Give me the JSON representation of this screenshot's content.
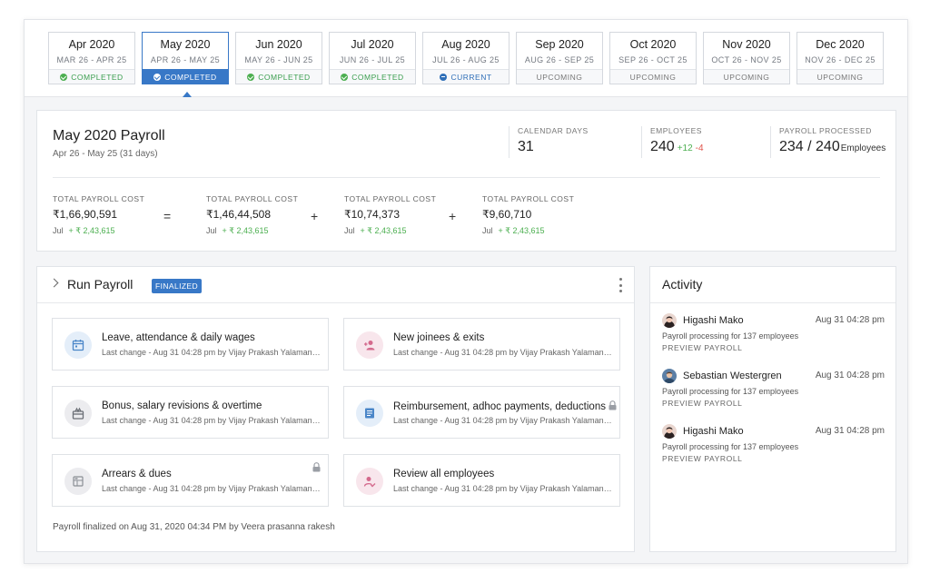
{
  "months": [
    {
      "title": "Apr 2020",
      "range": "MAR 26 - APR 25",
      "status": "COMPLETED"
    },
    {
      "title": "May 2020",
      "range": "APR 26 - MAY 25",
      "status": "COMPLETED"
    },
    {
      "title": "Jun 2020",
      "range": "MAY 26 - JUN 25",
      "status": "COMPLETED"
    },
    {
      "title": "Jul 2020",
      "range": "JUN 26 - JUL 25",
      "status": "COMPLETED"
    },
    {
      "title": "Aug 2020",
      "range": "JUL 26 - AUG 25",
      "status": "CURRENT"
    },
    {
      "title": "Sep 2020",
      "range": "AUG 26 - SEP 25",
      "status": "UPCOMING"
    },
    {
      "title": "Oct 2020",
      "range": "SEP 26 - OCT 25",
      "status": "UPCOMING"
    },
    {
      "title": "Nov 2020",
      "range": "OCT 26 - NOV 25",
      "status": "UPCOMING"
    },
    {
      "title": "Dec 2020",
      "range": "NOV 26 - DEC 25",
      "status": "UPCOMING"
    }
  ],
  "summary": {
    "title": "May 2020 Payroll",
    "subtitle": "Apr 26 - May 25 (31 days)",
    "calendar_days_label": "CALENDAR DAYS",
    "calendar_days": "31",
    "employees_label": "EMPLOYEES",
    "employees": "240",
    "employees_added": "+12",
    "employees_removed": "-4",
    "processed_label": "PAYROLL PROCESSED",
    "processed": "234 / 240",
    "processed_unit": "Employees",
    "costs": [
      {
        "label": "TOTAL PAYROLL COST",
        "value": "₹1,66,90,591",
        "month": "Jul",
        "delta": "+ ₹ 2,43,615"
      },
      {
        "label": "TOTAL PAYROLL COST",
        "value": "₹1,46,44,508",
        "month": "Jul",
        "delta": "+ ₹ 2,43,615"
      },
      {
        "label": "TOTAL PAYROLL COST",
        "value": "₹10,74,373",
        "month": "Jul",
        "delta": "+ ₹ 2,43,615"
      },
      {
        "label": "TOTAL PAYROLL COST",
        "value": "₹9,60,710",
        "month": "Jul",
        "delta": "+ ₹ 2,43,615"
      }
    ],
    "operators": [
      "=",
      "+",
      "+"
    ]
  },
  "run_payroll": {
    "title": "Run Payroll",
    "badge": "FINALIZED",
    "tasks": [
      {
        "title": "Leave, attendance & daily wages",
        "sub": "Last change - Aug 31 04:28 pm by Vijay Prakash Yalamanchili",
        "icon": "calendar-icon"
      },
      {
        "title": "New joinees & exits",
        "sub": "Last change - Aug 31 04:28 pm by Vijay Prakash Yalamanchili",
        "icon": "person-add-icon"
      },
      {
        "title": "Bonus, salary revisions & overtime",
        "sub": "Last change - Aug 31 04:28 pm by Vijay Prakash Yalamanchili",
        "icon": "gift-icon"
      },
      {
        "title": "Reimbursement, adhoc payments, deductions",
        "sub": "Last change - Aug 31 04:28 pm by Vijay Prakash Yalamanchili",
        "icon": "document-icon"
      },
      {
        "title": "Arrears & dues",
        "sub": "Last change - Aug 31 04:28 pm by Vijay Prakash Yalamanchili",
        "icon": "ledger-icon"
      },
      {
        "title": "Review all employees",
        "sub": "Last change - Aug 31 04:28 pm by Vijay Prakash Yalamanchili",
        "icon": "person-check-icon"
      }
    ],
    "footer": "Payroll finalized on Aug 31, 2020 04:34 PM by Veera prasanna rakesh"
  },
  "activity": {
    "title": "Activity",
    "items": [
      {
        "name": "Higashi Mako",
        "time": "Aug 31 04:28 pm",
        "desc": "Payroll processing for 137 employees",
        "link": "PREVIEW PAYROLL"
      },
      {
        "name": "Sebastian Westergren",
        "time": "Aug 31 04:28 pm",
        "desc": "Payroll processing for 137 employees",
        "link": "PREVIEW PAYROLL"
      },
      {
        "name": "Higashi Mako",
        "time": "Aug 31 04:28 pm",
        "desc": "Payroll processing for 137 employees",
        "link": "PREVIEW PAYROLL"
      }
    ]
  },
  "colors": {
    "accent": "#3878c7",
    "completed": "#3a9e4e",
    "positive": "#4caf50",
    "negative": "#e0534a"
  }
}
